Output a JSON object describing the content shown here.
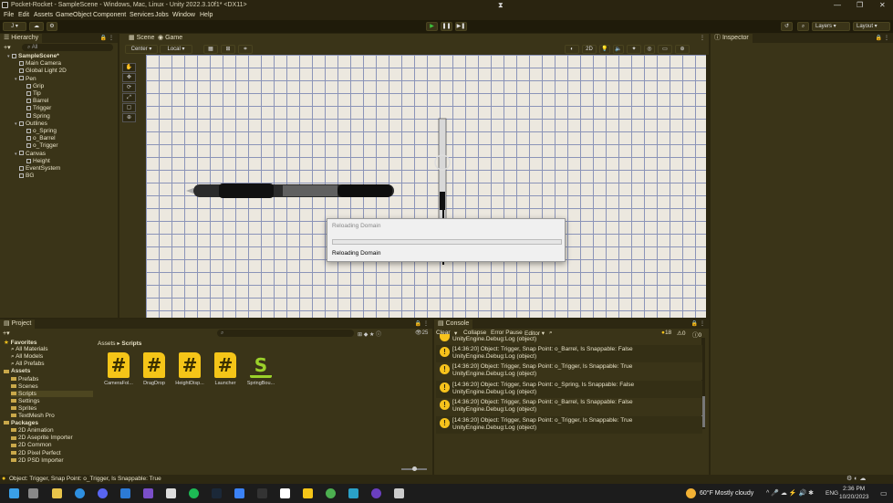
{
  "window": {
    "title": "Pocket-Rocket - SampleScene - Windows, Mac, Linux - Unity 2022.3.10f1* <DX11>"
  },
  "menu": [
    "File",
    "Edit",
    "Assets",
    "GameObject",
    "Component",
    "Services",
    "Jobs",
    "Window",
    "Help"
  ],
  "toolbar": {
    "account": "J",
    "layers": "Layers",
    "layout": "Layout"
  },
  "hierarchy": {
    "tab": "Hierarchy",
    "search_placeholder": "All",
    "items": [
      {
        "label": "SampleScene*",
        "indent": 0,
        "kind": "scene"
      },
      {
        "label": "Main Camera",
        "indent": 1
      },
      {
        "label": "Global Light 2D",
        "indent": 1
      },
      {
        "label": "Pen",
        "indent": 1
      },
      {
        "label": "Grip",
        "indent": 2
      },
      {
        "label": "Tip",
        "indent": 2
      },
      {
        "label": "Barrel",
        "indent": 2
      },
      {
        "label": "Trigger",
        "indent": 2
      },
      {
        "label": "Spring",
        "indent": 2
      },
      {
        "label": "Outlines",
        "indent": 1
      },
      {
        "label": "o_Spring",
        "indent": 2
      },
      {
        "label": "o_Barrel",
        "indent": 2
      },
      {
        "label": "o_Trigger",
        "indent": 2
      },
      {
        "label": "Canvas",
        "indent": 1
      },
      {
        "label": "Height",
        "indent": 2
      },
      {
        "label": "EventSystem",
        "indent": 1
      },
      {
        "label": "BG",
        "indent": 1
      }
    ]
  },
  "scene_view": {
    "tabs": [
      "Scene",
      "Game"
    ],
    "pivot": "Center",
    "space": "Local",
    "mode_2d": "2D"
  },
  "dialog": {
    "title": "Reloading Domain",
    "status": "Reloading Domain"
  },
  "inspector": {
    "tab": "Inspector"
  },
  "project": {
    "tab": "Project",
    "breadcrumb_root": "Assets",
    "breadcrumb_current": "Scripts",
    "hidden_count": "25",
    "tree": [
      {
        "label": "Favorites",
        "indent": 0,
        "kind": "star"
      },
      {
        "label": "All Materials",
        "indent": 1
      },
      {
        "label": "All Models",
        "indent": 1
      },
      {
        "label": "All Prefabs",
        "indent": 1
      },
      {
        "label": "Assets",
        "indent": 0,
        "kind": "folder"
      },
      {
        "label": "Prefabs",
        "indent": 1
      },
      {
        "label": "Scenes",
        "indent": 1
      },
      {
        "label": "Scripts",
        "indent": 1
      },
      {
        "label": "Settings",
        "indent": 1
      },
      {
        "label": "Sprites",
        "indent": 1
      },
      {
        "label": "TextMesh Pro",
        "indent": 1
      },
      {
        "label": "Packages",
        "indent": 0,
        "kind": "folder"
      },
      {
        "label": "2D Animation",
        "indent": 1
      },
      {
        "label": "2D Aseprite Importer",
        "indent": 1
      },
      {
        "label": "2D Common",
        "indent": 1
      },
      {
        "label": "2D Pixel Perfect",
        "indent": 1
      },
      {
        "label": "2D PSD Importer",
        "indent": 1
      }
    ],
    "assets": [
      {
        "label": "CameraFol...",
        "glyph": "#"
      },
      {
        "label": "DragDrop",
        "glyph": "#"
      },
      {
        "label": "HeightDisp...",
        "glyph": "#"
      },
      {
        "label": "Launcher",
        "glyph": "#"
      },
      {
        "label": "SpringBou...",
        "glyph": "S"
      }
    ]
  },
  "console": {
    "tab": "Console",
    "clear": "Clear",
    "collapse": "Collapse",
    "error_pause": "Error Pause",
    "editor": "Editor",
    "warn_count": "18",
    "err_count": "0",
    "info_count": "0",
    "top_partial": "UnityEngine.Debug:Log (object)",
    "entries": [
      {
        "line1": "[14:36:20] Object: Trigger, Snap Point: o_Barrel, Is Snappable: False",
        "line2": "UnityEngine.Debug:Log (object)"
      },
      {
        "line1": "[14:36:20] Object: Trigger, Snap Point: o_Trigger, Is Snappable: True",
        "line2": "UnityEngine.Debug:Log (object)"
      },
      {
        "line1": "[14:36:20] Object: Trigger, Snap Point: o_Spring, Is Snappable: False",
        "line2": "UnityEngine.Debug:Log (object)"
      },
      {
        "line1": "[14:36:20] Object: Trigger, Snap Point: o_Barrel, Is Snappable: False",
        "line2": "UnityEngine.Debug:Log (object)"
      },
      {
        "line1": "[14:36:20] Object: Trigger, Snap Point: o_Trigger, Is Snappable: True",
        "line2": "UnityEngine.Debug:Log (object)"
      }
    ]
  },
  "status": {
    "message": "Object: Trigger, Snap Point: o_Trigger, Is Snappable: True"
  },
  "taskbar": {
    "weather": "60°F  Mostly cloudy",
    "lang": "ENG",
    "time": "2:36 PM",
    "date": "10/20/2023"
  },
  "colors": {
    "accent": "#f7c31c",
    "play": "#3ec43e"
  }
}
